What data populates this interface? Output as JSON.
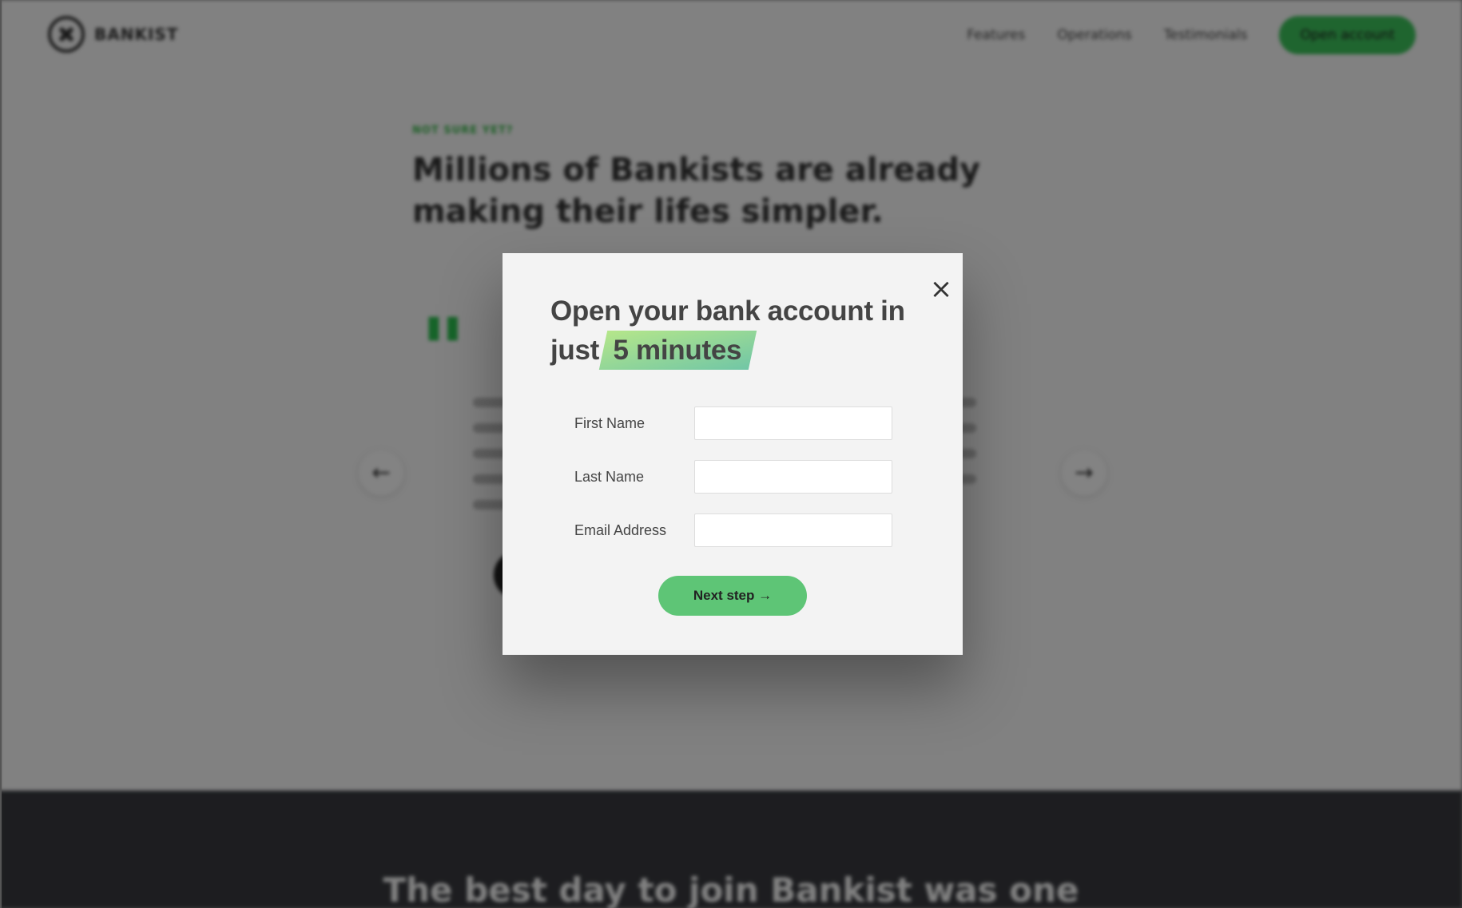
{
  "background": {
    "nav": {
      "logo_text": "BANKIST",
      "links": [
        "Features",
        "Operations",
        "Testimonials"
      ],
      "cta": "Open account"
    },
    "section": {
      "subtitle": "Not sure yet?",
      "title": "Millions of Bankists are already making their lifes simpler."
    },
    "slider": {
      "prev_arrow": "←",
      "next_arrow": "→"
    }
  },
  "modal": {
    "close_label": "×",
    "title_prefix": "Open your bank account in just",
    "title_highlight": "5 minutes",
    "fields": [
      {
        "label": "First Name",
        "value": ""
      },
      {
        "label": "Last Name",
        "value": ""
      },
      {
        "label": "Email Address",
        "value": ""
      }
    ],
    "submit_label": "Next step →"
  },
  "footer": {
    "title": "The best day to join Bankist was one"
  },
  "colors": {
    "accent_green": "#5ec576",
    "overlay": "rgba(0,0,0,0.47)",
    "modal_bg": "#f3f3f3"
  }
}
